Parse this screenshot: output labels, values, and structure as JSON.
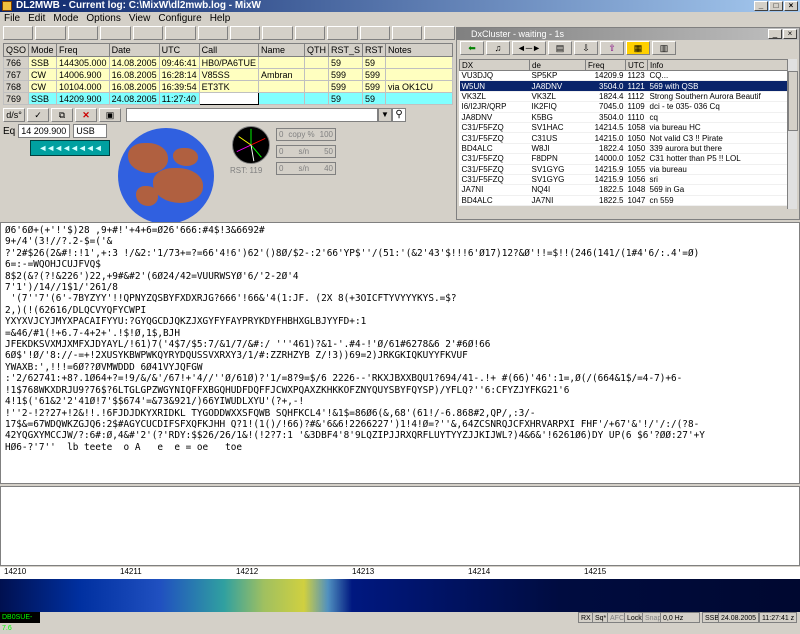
{
  "window": {
    "title": "DL2MWB - Current log: C:\\MixW\\dl2mwb.log - MixW"
  },
  "menu": [
    "File",
    "Edit",
    "Mode",
    "Options",
    "View",
    "Configure",
    "Help"
  ],
  "log": {
    "columns": [
      "QSO",
      "Mode",
      "Freq",
      "Date",
      "UTC",
      "Call",
      "Name",
      "QTH",
      "RST_S",
      "RST",
      "Notes"
    ],
    "rows": [
      {
        "qso": "766",
        "mode": "SSB",
        "freq": "144305.000",
        "date": "14.08.2005",
        "utc": "09:46:41",
        "call": "HB0/PA6TUE",
        "name": "",
        "qth": "",
        "rst_s": "59",
        "rst": "59",
        "notes": ""
      },
      {
        "qso": "767",
        "mode": "CW",
        "freq": "14006.900",
        "date": "16.08.2005",
        "utc": "16:28:14",
        "call": "V85SS",
        "name": "Ambran",
        "qth": "",
        "rst_s": "599",
        "rst": "599",
        "notes": ""
      },
      {
        "qso": "768",
        "mode": "CW",
        "freq": "10104.000",
        "date": "16.08.2005",
        "utc": "16:39:54",
        "call": "ET3TK",
        "name": "",
        "qth": "",
        "rst_s": "599",
        "rst": "599",
        "notes": "via OK1CU"
      },
      {
        "qso": "769",
        "mode": "SSB",
        "freq": "14209.900",
        "date": "24.08.2005",
        "utc": "11:27:40",
        "call": "",
        "name": "",
        "qth": "",
        "rst_s": "59",
        "rst": "59",
        "notes": ""
      }
    ]
  },
  "controls": {
    "freq": "14 209.900",
    "freq_label": "Eq",
    "mode": "USB",
    "arrows": "◄◄◄◄◄◄◄◄"
  },
  "meters": {
    "copy_label": "copy %",
    "copy_left": "0",
    "copy_right": "100",
    "row2_left": "0",
    "row2_mid": "s/n",
    "row2_right": "50",
    "row3_left": "0",
    "row3_mid": "s/n",
    "row3_right": "40",
    "rst": "RST: 119"
  },
  "dxcluster": {
    "title": "DxCluster - waiting - 1s",
    "columns": [
      "DX",
      "de",
      "Freq",
      "UTC",
      "Info"
    ],
    "rows": [
      {
        "dx": "VU3DJQ",
        "de": "SP5KP",
        "freq": "14209.9",
        "utc": "1123",
        "info": "CQ..."
      },
      {
        "dx": "W5UN",
        "de": "JA8DNV",
        "freq": "3504.0",
        "utc": "1121",
        "info": "569 with QSB"
      },
      {
        "dx": "VK3ZL",
        "de": "VK3ZL",
        "freq": "1824.4",
        "utc": "1112",
        "info": "Strong Southern Aurora Beautif"
      },
      {
        "dx": "I6/I2JR/QRP",
        "de": "IK2FIQ",
        "freq": "7045.0",
        "utc": "1109",
        "info": "dci - te 035- 036 Cq"
      },
      {
        "dx": "JA8DNV",
        "de": "K5BG",
        "freq": "3504.0",
        "utc": "1110",
        "info": "cq"
      },
      {
        "dx": "C31/F5FZQ",
        "de": "SV1HAC",
        "freq": "14214.5",
        "utc": "1058",
        "info": "via bureau HC"
      },
      {
        "dx": "C31/F5FZQ",
        "de": "C31US",
        "freq": "14215.0",
        "utc": "1050",
        "info": "Not valid C3 !! Pirate"
      },
      {
        "dx": "BD4ALC",
        "de": "W8JI",
        "freq": "1822.4",
        "utc": "1050",
        "info": "339 aurora but there"
      },
      {
        "dx": "C31/F5FZQ",
        "de": "F8DPN",
        "freq": "14000.0",
        "utc": "1052",
        "info": "C31 hotter than P5 !! LOL"
      },
      {
        "dx": "C31/F5FZQ",
        "de": "SV1GYG",
        "freq": "14215.9",
        "utc": "1055",
        "info": "via bureau"
      },
      {
        "dx": "C31/F5FZQ",
        "de": "SV1GYG",
        "freq": "14215.9",
        "utc": "1056",
        "info": "sri"
      },
      {
        "dx": "JA7NI",
        "de": "NQ4I",
        "freq": "1822.5",
        "utc": "1048",
        "info": "569 in Ga"
      },
      {
        "dx": "BD4ALC",
        "de": "JA7NI",
        "freq": "1822.5",
        "utc": "1047",
        "info": "cn 559"
      }
    ]
  },
  "rx_text": "Ø6'6Ø+(+'!'$)28 ,9+#!'+4+6=Ø26'666:#4$!3&6692#\n9+/4'(3!//?.2-$=('&\n?'2#$26(2&#!:!1',+:3 !/&2:'1/73+=?=66'4!6')62'()8Ø/$2-:2'66'YP$''/(51:'(&2'43'$!!!6'Ø17)12?&Ø'!!=$!!(246(141/(1#4'6/:.4'=Ø)\n6=:-=WQOHJCUJFVQ$\n8$2(&?(?!&226')22,+9#&#2'(6Ø24/42=VUURWSYØ'6/'2-2Ø'4\n7'1')/14//1$1/'261/8\n '(7''7'(6'-7BYZYY'!!QPNYZQSBYFXDXRJG?666'!66&'4(1:JF. (2X 8(+3OICFTYVYYYKYS.=$?\n2,)(!(62616/DLQCVYQFYCWPI\nYXYXVJCYJMYXPACAIFYYU:?GYQGCDJQKZJXGYFYFAYPRYKDYFHBHXGLBJYYFD+:1\n=&46/#1(!+6.7-4+2+'.!$!Ø,1$,BJH\nJFEKDKSVXMJXMFXJDYAYL/!61)7('4$7/$5:7/&1/7/&#:/ '''461)?&1-'.#4-!'Ø/61#6278&6 2'#6Ø!66\n6Ø$'!Ø/'8://-=+!2XUSYKBWPWKQYRYDQUSSVXRXY3/1/#:ZZRHZYB Z/!3))69=2)JRKGKIQKUYYFKVUF\nYWAXB:',!!!=6Ø??ØVMWDDD 6Ø41VYJQFGW\n:'2/62741:+8?.1Ø64+?=!9/&/&'/67!+'4//''Ø/61Ø)?'1/=8?9=$/6 2226--'RKXJBXXBQU1?694/41-.!+ #(66)'46':1=,Ø(/(664&1$/=4-7)+6-\n!1$768WKXDRJU9?76$?6LTGLGPZWGYNIQFFXBGQHUDFDQFFJCWXPQAXZKHKKOFZNYQUYSBYFQYSP)/YFLQ?''6:CFYZJYFKG21'6\n4!1$('61&2'2'41Ø!7'$$674'=&73&921/)66YIWUDLXYU'(?+,-!\n!''2-!2?27+!2&!!.!6FJDJDKYXRIDKL TYGODDWXXSFQWB SQHFKCL4'!&1$=86Ø6(&,68'(61!/-6.868#2,QP/,:3/-\n17$&=67WDQWKZGJQ6:2$#AGYCUCDIFSFXQFKJHH Q?1!(1()/!66)?#&'6&6!2266227')1!4!Ø=?''&,64ZCSNRQJCFXHRVARPXI FHF'/+67'&'!/'/:/(?8-\n42YQGXYMCCJW/?:6#:Ø,4&#'2'(?'RDY:$$26/26/1&!(!2?7:1 '&3DBF4'8'9LQZIPJJRXQRFLUYTYYZJJKIJWL?)4&6&'!6261Ø6)DY UP(6 $6'?ØØ:27'+Y\nHØ6-?'7''  lb teete  o A   e  e = oe   toe",
  "spectrum": {
    "ticks": [
      "14210",
      "14211",
      "14212",
      "14213",
      "14214",
      "14215"
    ]
  },
  "status": {
    "callsign": "DB0SUE-7.6",
    "rx": "RX",
    "sq": "Sq*",
    "afc": "AFC",
    "lock": "Lock",
    "snap": "Snap",
    "offset": "0,0 Hz",
    "mode": "SSB",
    "date": "24.08.2005",
    "time": "11:27:41 z"
  }
}
